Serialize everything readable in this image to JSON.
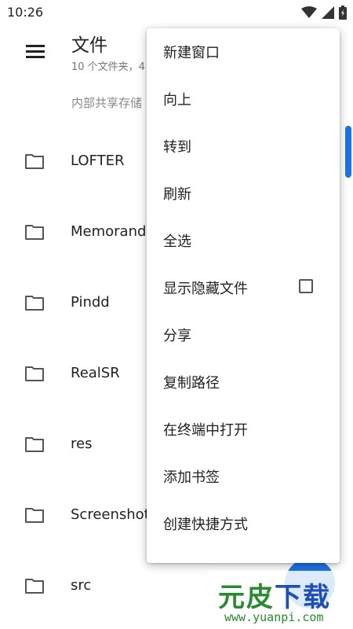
{
  "status": {
    "time": "10:26"
  },
  "appbar": {
    "title": "文件",
    "subtitle": "10 个文件夹，4"
  },
  "breadcrumb": "内部共享存储",
  "folders": [
    {
      "name": "LOFTER"
    },
    {
      "name": "Memorandum"
    },
    {
      "name": "Pindd"
    },
    {
      "name": "RealSR"
    },
    {
      "name": "res"
    },
    {
      "name": "Screenshots"
    },
    {
      "name": "src"
    }
  ],
  "menu": {
    "items": [
      {
        "label": "新建窗口"
      },
      {
        "label": "向上"
      },
      {
        "label": "转到"
      },
      {
        "label": "刷新"
      },
      {
        "label": "全选"
      },
      {
        "label": "显示隐藏文件",
        "checked": false
      },
      {
        "label": "分享"
      },
      {
        "label": "复制路径"
      },
      {
        "label": "在终端中打开"
      },
      {
        "label": "添加书签"
      },
      {
        "label": "创建快捷方式"
      }
    ]
  },
  "watermark": {
    "part1": "元皮",
    "part2": "下载",
    "url": "www.yuanpi.com"
  },
  "colors": {
    "accent": "#1a73e8",
    "watermark_green": "#2a8a2f",
    "watermark_blue": "#1c4fb8"
  },
  "icons": {
    "menu": "hamburger-menu-icon",
    "folder": "folder-icon",
    "wifi": "wifi-icon",
    "signal": "signal-icon",
    "battery": "battery-icon"
  }
}
